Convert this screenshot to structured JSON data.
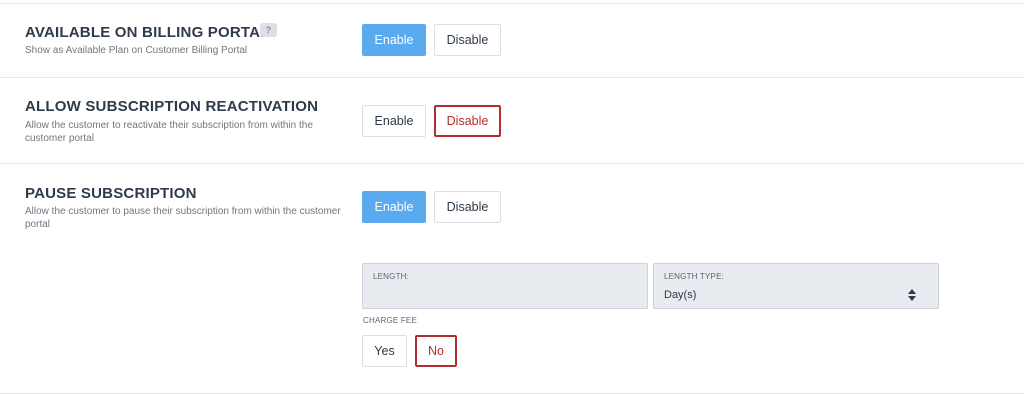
{
  "sections": [
    {
      "title": "AVAILABLE ON BILLING PORTAL",
      "help": "?",
      "description": "Show as Available Plan on Customer Billing Portal",
      "enable_label": "Enable",
      "disable_label": "Disable",
      "selected": "Enable"
    },
    {
      "title": "ALLOW SUBSCRIPTION REACTIVATION",
      "description": "Allow the customer to reactivate their subscription from within the customer portal",
      "enable_label": "Enable",
      "disable_label": "Disable",
      "selected": "Disable"
    },
    {
      "title": "PAUSE SUBSCRIPTION",
      "description": "Allow the customer to pause their subscription from within the customer portal",
      "enable_label": "Enable",
      "disable_label": "Disable",
      "selected": "Enable"
    }
  ],
  "pause_options": {
    "length": {
      "label": "LENGTH:",
      "value": ""
    },
    "length_type": {
      "label": "LENGTH TYPE:",
      "value": "Day(s)"
    },
    "charge_fee": {
      "label": "CHARGE FEE",
      "yes_label": "Yes",
      "no_label": "No",
      "selected": "No"
    }
  },
  "colors": {
    "primary": "#5aaaf0",
    "danger": "#b22e2e",
    "field_bg": "#e8ebef"
  },
  "icons": {
    "help": "question-mark",
    "select": "sort-arrows"
  }
}
